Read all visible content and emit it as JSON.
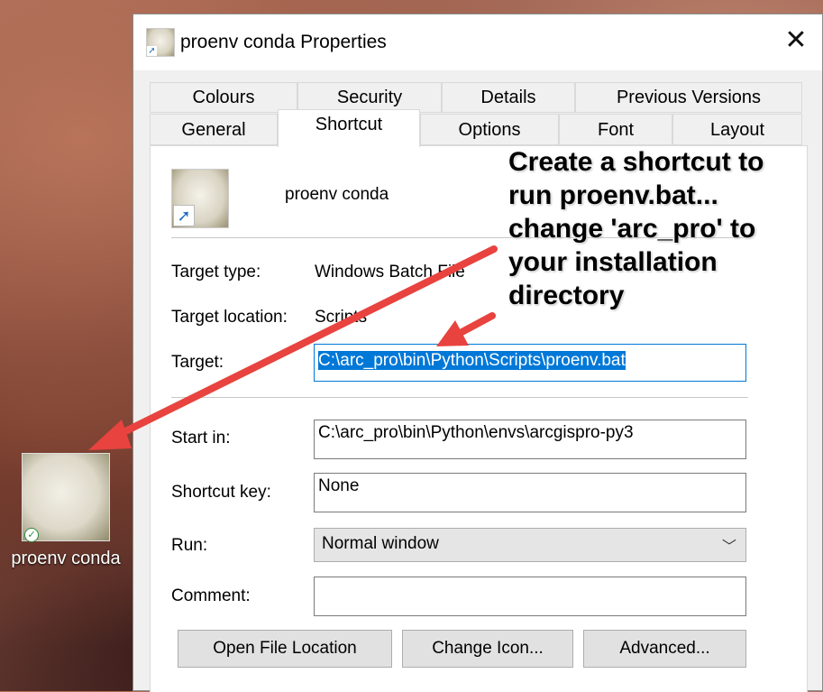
{
  "desktop": {
    "icon_label": "proenv conda"
  },
  "dialog": {
    "title": "proenv conda Properties",
    "close_glyph": "✕",
    "tabs_row1": [
      "Colours",
      "Security",
      "Details",
      "Previous Versions"
    ],
    "tabs_row2": [
      "General",
      "Shortcut",
      "Options",
      "Font",
      "Layout"
    ],
    "active_tab": "Shortcut",
    "shortcut_name": "proenv conda",
    "fields": {
      "target_type_label": "Target type:",
      "target_type_value": "Windows Batch File",
      "target_location_label": "Target location:",
      "target_location_value": "Scripts",
      "target_label": "Target:",
      "target_value": "C:\\arc_pro\\bin\\Python\\Scripts\\proenv.bat",
      "start_in_label": "Start in:",
      "start_in_value": "C:\\arc_pro\\bin\\Python\\envs\\arcgispro-py3",
      "shortcut_key_label": "Shortcut key:",
      "shortcut_key_value": "None",
      "run_label": "Run:",
      "run_value": "Normal window",
      "comment_label": "Comment:",
      "comment_value": ""
    },
    "buttons": {
      "open_file_location": "Open File Location",
      "change_icon": "Change Icon...",
      "advanced": "Advanced..."
    }
  },
  "annotation": {
    "lines": [
      "Create a shortcut to",
      "run proenv.bat...",
      "change 'arc_pro' to",
      "your installation",
      "directory"
    ],
    "arrow_color": "#e8433f"
  },
  "colors": {
    "selection": "#0078d7",
    "icon_arrow": "#1f6fbf",
    "check": "#2e8b3c"
  }
}
